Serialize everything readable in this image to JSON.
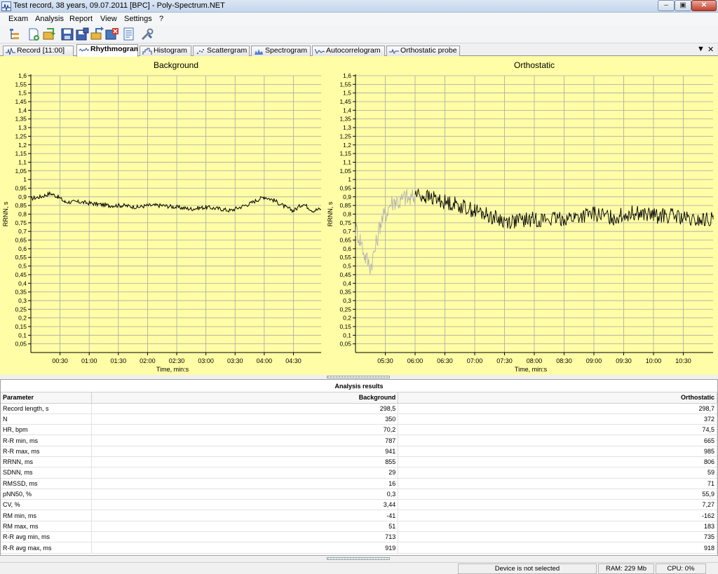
{
  "window": {
    "title": "Test record, 38 years, 09.07.2011 [BPC] - Poly-Spectrum.NET"
  },
  "menu": [
    "Exam",
    "Analysis",
    "Report",
    "View",
    "Settings",
    "?"
  ],
  "toolbar": {
    "icons": [
      "tree-icon",
      "open-exam-icon",
      "import-icon",
      "save-icon",
      "save-as-icon",
      "export-icon",
      "close-exam-icon",
      "report-icon",
      "tools-icon"
    ]
  },
  "tabs": [
    {
      "label": "Record [11:00]",
      "active": false,
      "icon": "ecg-icon"
    },
    {
      "label": "Rhythmogram",
      "active": true,
      "icon": "rhythm-icon"
    },
    {
      "label": "Histogram",
      "active": false,
      "icon": "histogram-icon"
    },
    {
      "label": "Scattergram",
      "active": false,
      "icon": "scatter-icon"
    },
    {
      "label": "Spectrogram",
      "active": false,
      "icon": "spectrum-icon"
    },
    {
      "label": "Autocorrelogram",
      "active": false,
      "icon": "autocorr-icon"
    },
    {
      "label": "Orthostatic probe",
      "active": false,
      "icon": "probe-icon"
    }
  ],
  "chart_data": [
    {
      "type": "line",
      "title": "Background",
      "xlabel": "Time, min:s",
      "ylabel": "RRNN, s",
      "ylim": [
        0,
        1.6
      ],
      "yticks": [
        "0,05",
        "0,1",
        "0,15",
        "0,2",
        "0,25",
        "0,3",
        "0,35",
        "0,4",
        "0,45",
        "0,5",
        "0,55",
        "0,6",
        "0,65",
        "0,7",
        "0,75",
        "0,8",
        "0,85",
        "0,9",
        "0,95",
        "1",
        "1,05",
        "1,1",
        "1,15",
        "1,2",
        "1,25",
        "1,3",
        "1,35",
        "1,4",
        "1,45",
        "1,5",
        "1,55",
        "1,6"
      ],
      "xlim": [
        0,
        298.5
      ],
      "xticks": [
        {
          "t": 30,
          "label": "00:30"
        },
        {
          "t": 60,
          "label": "01:00"
        },
        {
          "t": 90,
          "label": "01:30"
        },
        {
          "t": 120,
          "label": "02:00"
        },
        {
          "t": 150,
          "label": "02:30"
        },
        {
          "t": 180,
          "label": "03:00"
        },
        {
          "t": 210,
          "label": "03:30"
        },
        {
          "t": 240,
          "label": "04:00"
        },
        {
          "t": 270,
          "label": "04:30"
        }
      ],
      "grid": true,
      "series": [
        {
          "color": "#000000",
          "x": [
            0,
            10,
            20,
            28,
            35,
            50,
            65,
            80,
            95,
            110,
            120,
            135,
            150,
            165,
            180,
            195,
            205,
            215,
            225,
            232,
            240,
            250,
            262,
            270,
            280,
            290,
            298
          ],
          "y": [
            0.89,
            0.9,
            0.92,
            0.9,
            0.87,
            0.87,
            0.86,
            0.85,
            0.85,
            0.84,
            0.85,
            0.85,
            0.84,
            0.83,
            0.84,
            0.83,
            0.82,
            0.84,
            0.86,
            0.88,
            0.9,
            0.88,
            0.84,
            0.82,
            0.86,
            0.82,
            0.83
          ]
        }
      ]
    },
    {
      "type": "line",
      "title": "Orthostatic",
      "xlabel": "Time, min:s",
      "ylabel": "RRNN, s",
      "ylim": [
        0,
        1.6
      ],
      "yticks": [
        "0,05",
        "0,1",
        "0,15",
        "0,2",
        "0,25",
        "0,3",
        "0,35",
        "0,4",
        "0,45",
        "0,5",
        "0,55",
        "0,6",
        "0,65",
        "0,7",
        "0,75",
        "0,8",
        "0,85",
        "0,9",
        "0,95",
        "1",
        "1,05",
        "1,1",
        "1,15",
        "1,2",
        "1,25",
        "1,3",
        "1,35",
        "1,4",
        "1,45",
        "1,5",
        "1,55",
        "1,6"
      ],
      "xlim": [
        300,
        660
      ],
      "xticks": [
        {
          "t": 330,
          "label": "05:30"
        },
        {
          "t": 360,
          "label": "06:00"
        },
        {
          "t": 390,
          "label": "06:30"
        },
        {
          "t": 420,
          "label": "07:00"
        },
        {
          "t": 450,
          "label": "07:30"
        },
        {
          "t": 480,
          "label": "08:00"
        },
        {
          "t": 510,
          "label": "08:30"
        },
        {
          "t": 540,
          "label": "09:00"
        },
        {
          "t": 570,
          "label": "09:30"
        },
        {
          "t": 600,
          "label": "10:00"
        },
        {
          "t": 630,
          "label": "10:30"
        }
      ],
      "grid": true,
      "series": [
        {
          "color": "#b4b4b4",
          "x": [
            300,
            305,
            310,
            315,
            320,
            325,
            330,
            335,
            340,
            345,
            350,
            355,
            360
          ],
          "y": [
            0.72,
            0.65,
            0.55,
            0.5,
            0.6,
            0.75,
            0.8,
            0.86,
            0.88,
            0.87,
            0.9,
            0.88,
            0.9
          ]
        },
        {
          "color": "#000000",
          "x": [
            360,
            370,
            380,
            390,
            400,
            410,
            420,
            430,
            440,
            450,
            460,
            480,
            500,
            520,
            540,
            560,
            580,
            600,
            620,
            640,
            660
          ],
          "y": [
            0.92,
            0.9,
            0.89,
            0.87,
            0.86,
            0.84,
            0.82,
            0.8,
            0.78,
            0.76,
            0.76,
            0.77,
            0.77,
            0.78,
            0.8,
            0.78,
            0.81,
            0.79,
            0.79,
            0.76,
            0.77
          ]
        }
      ]
    }
  ],
  "results": {
    "title": "Analysis results",
    "headers": [
      "Parameter",
      "Background",
      "Orthostatic"
    ],
    "rows": [
      [
        "Record length, s",
        "298,5",
        "298,7"
      ],
      [
        "N",
        "350",
        "372"
      ],
      [
        "HR, bpm",
        "70,2",
        "74,5"
      ],
      [
        "R-R min, ms",
        "787",
        "665"
      ],
      [
        "R-R max, ms",
        "941",
        "985"
      ],
      [
        "RRNN, ms",
        "855",
        "806"
      ],
      [
        "SDNN, ms",
        "29",
        "59"
      ],
      [
        "RMSSD, ms",
        "16",
        "71"
      ],
      [
        "pNN50, %",
        "0,3",
        "55,9"
      ],
      [
        "CV, %",
        "3,44",
        "7,27"
      ],
      [
        "RM min, ms",
        "-41",
        "-162"
      ],
      [
        "RM max, ms",
        "51",
        "183"
      ],
      [
        "R-R avg min, ms",
        "713",
        "735"
      ],
      [
        "R-R avg max, ms",
        "919",
        "918"
      ]
    ]
  },
  "status": {
    "device": "Device is not selected",
    "ram": "RAM: 229 Mb",
    "cpu": "CPU: 0%"
  },
  "colors": {
    "plot_background": "#fffda5",
    "grid": "#a8a8a8",
    "series_main": "#000000",
    "series_transition": "#b4b4b4"
  }
}
